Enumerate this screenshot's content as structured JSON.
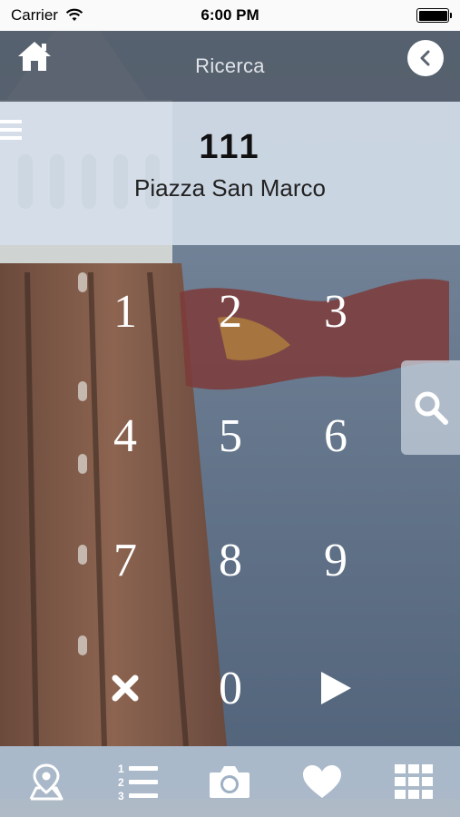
{
  "status_bar": {
    "carrier": "Carrier",
    "time": "6:00 PM"
  },
  "nav": {
    "title": "Ricerca",
    "home_icon": "home-icon",
    "back_icon": "chevron-left-icon"
  },
  "result": {
    "code": "111",
    "place": "Piazza San Marco"
  },
  "keypad": {
    "keys": [
      "1",
      "2",
      "3",
      "4",
      "5",
      "6",
      "7",
      "8",
      "9",
      "0"
    ],
    "clear_icon": "close-icon",
    "go_icon": "play-icon"
  },
  "search_tab": {
    "icon": "search-icon"
  },
  "tab_bar": {
    "items": [
      {
        "name": "map",
        "icon": "map-pin-icon"
      },
      {
        "name": "list",
        "icon": "numbered-list-icon"
      },
      {
        "name": "camera",
        "icon": "camera-icon"
      },
      {
        "name": "favorites",
        "icon": "heart-icon"
      },
      {
        "name": "grid",
        "icon": "grid-icon"
      }
    ]
  },
  "colors": {
    "nav_bg": "#505a66",
    "panel_bg": "#d4deea",
    "tab_bar_bg": "#bac8d7",
    "sky": "#5a6b7e",
    "tower_brick": "#8a5c45"
  }
}
